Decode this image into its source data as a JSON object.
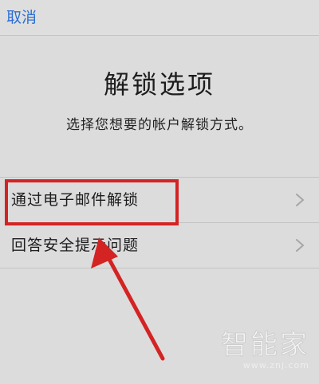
{
  "nav": {
    "cancel_label": "取消"
  },
  "header": {
    "title": "解锁选项",
    "subtitle": "选择您想要的帐户解锁方式。"
  },
  "options": [
    {
      "label": "通过电子邮件解锁",
      "icon": "chevron-right-icon"
    },
    {
      "label": "回答安全提示问题",
      "icon": "chevron-right-icon"
    }
  ],
  "annotation": {
    "highlight_color": "#d42323"
  },
  "watermark": {
    "logo_text": "智能家",
    "url": "www.znj.com"
  },
  "colors": {
    "background": "#dcdcdc",
    "link_blue": "#2b6fd6",
    "divider": "#c4c4c4"
  }
}
